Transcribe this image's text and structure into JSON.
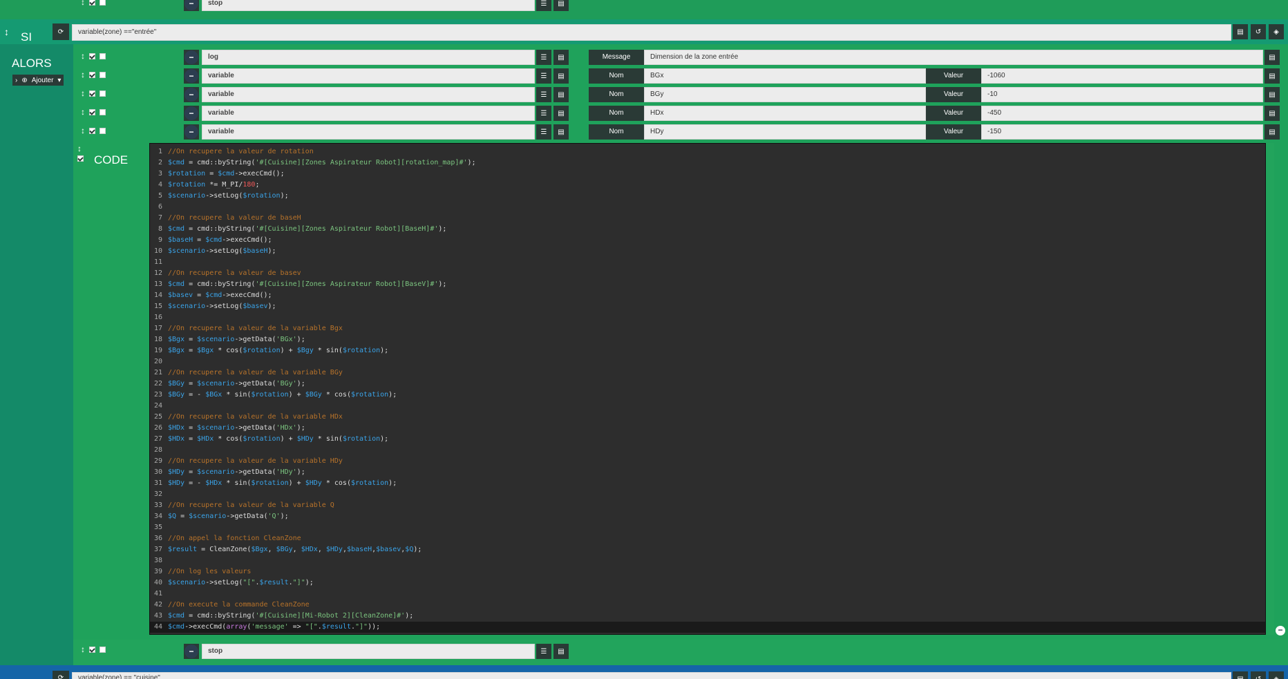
{
  "sections": {
    "si": "SI",
    "alors": "ALORS",
    "code": "CODE"
  },
  "add_button": "Ajouter",
  "top_stop": "stop",
  "condition": "variable(zone) ==\"entrée\"",
  "next_condition": "variable(zone) == \"cuisine\"",
  "actions": [
    {
      "type": "log",
      "label1": "Message",
      "value1": "Dimension de la zone entrée"
    },
    {
      "type": "variable",
      "label1": "Nom",
      "value1": "BGx",
      "label2": "Valeur",
      "value2": "-1060"
    },
    {
      "type": "variable",
      "label1": "Nom",
      "value1": "BGy",
      "label2": "Valeur",
      "value2": "-10"
    },
    {
      "type": "variable",
      "label1": "Nom",
      "value1": "HDx",
      "label2": "Valeur",
      "value2": "-450"
    },
    {
      "type": "variable",
      "label1": "Nom",
      "value1": "HDy",
      "label2": "Valeur",
      "value2": "-150"
    }
  ],
  "bottom_stop": "stop",
  "code_lines": [
    "//On recupere la valeur de rotation",
    "$cmd = cmd::byString('#[Cuisine][Zones Aspirateur Robot][rotation_map]#');",
    "$rotation = $cmd->execCmd();",
    "$rotation *= M_PI/180;",
    "$scenario->setLog($rotation);",
    "",
    "//On recupere la valeur de baseH",
    "$cmd = cmd::byString('#[Cuisine][Zones Aspirateur Robot][BaseH]#');",
    "$baseH = $cmd->execCmd();",
    "$scenario->setLog($baseH);",
    "",
    "//On recupere la valeur de basev",
    "$cmd = cmd::byString('#[Cuisine][Zones Aspirateur Robot][BaseV]#');",
    "$basev = $cmd->execCmd();",
    "$scenario->setLog($basev);",
    "",
    "//On recupere la valeur de la variable Bgx",
    "$Bgx = $scenario->getData('BGx');",
    "$Bgx = $Bgx * cos($rotation) + $Bgy * sin($rotation);",
    "",
    "//On recupere la valeur de la variable BGy",
    "$BGy = $scenario->getData('BGy');",
    "$BGy = - $BGx * sin($rotation) + $BGy * cos($rotation);",
    "",
    "//On recupere la valeur de la variable HDx",
    "$HDx = $scenario->getData('HDx');",
    "$HDx = $HDx * cos($rotation) + $HDy * sin($rotation);",
    "",
    "//On recupere la valeur de la variable HDy",
    "$HDy = $scenario->getData('HDy');",
    "$HDy = - $HDx * sin($rotation) + $HDy * cos($rotation);",
    "",
    "//On recupere la valeur de la variable Q",
    "$Q = $scenario->getData('Q');",
    "",
    "//On appel la fonction CleanZone",
    "$result = CleanZone($Bgx, $BGy, $HDx, $HDy,$baseH,$basev,$Q);",
    "",
    "//On log les valeurs",
    "$scenario->setLog(\"[\".$result.\"]\");",
    "",
    "//On execute la commande CleanZone",
    "$cmd = cmd::byString('#[Cuisine][Mi-Robot 2][CleanZone]#');",
    "$cmd->execCmd(array('message' => \"[\".$result.\"]\"));"
  ]
}
